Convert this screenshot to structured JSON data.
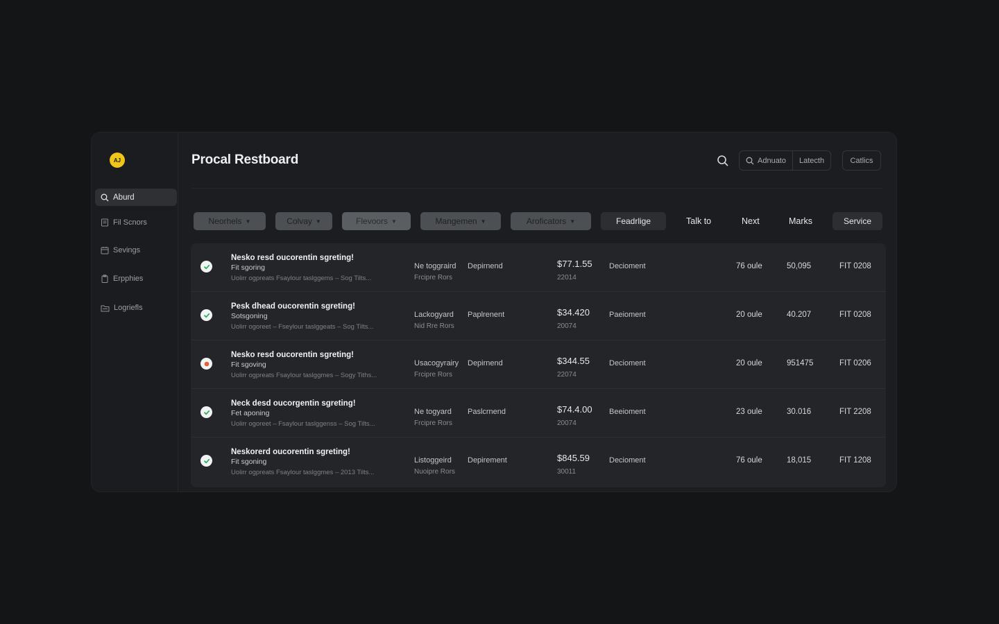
{
  "app": {
    "logo_text": "AJ",
    "title": "Procal Restboard"
  },
  "sidebar": {
    "search_label": "Aburd",
    "items": [
      {
        "label": "Fil Scnors",
        "icon": "document-icon"
      },
      {
        "label": "Sevings",
        "icon": "calendar-icon"
      },
      {
        "label": "Erpphies",
        "icon": "clipboard-icon"
      },
      {
        "label": "Logriefls",
        "icon": "folder-icon"
      }
    ]
  },
  "header": {
    "actions": [
      {
        "label": "Adnuato",
        "icon": "search-icon"
      },
      {
        "label": "Latecth"
      },
      {
        "label": "Catlics"
      }
    ]
  },
  "filters": {
    "dropdowns": [
      "Neorhels",
      "Colvay",
      "Flevoors",
      "Mangemen",
      "Aroficators"
    ],
    "active_tab": "Feadrlige",
    "tabs": [
      "Talk to",
      "Next",
      "Marks"
    ],
    "service_label": "Service"
  },
  "table": {
    "rows": [
      {
        "status": "ok",
        "title": "Nesko resd oucorentin sgreting!",
        "subtitle": "Fit sgoring",
        "detail": "Uolirr ogpreats Fsaylour taslggems – Sog Tilts...",
        "col_a_1": "Ne toggraird",
        "col_a_2": "Frcipre Rors",
        "col_b": "Depirnend",
        "price": "$77.1.55",
        "price_sub": "22014",
        "col_c": "Decioment",
        "col_d": "76 oule",
        "col_e": "50,095",
        "col_f": "FIT 0208"
      },
      {
        "status": "ok",
        "title": "Pesk dhead oucorentin sgreting!",
        "subtitle": "Sotsgoning",
        "detail": "Uolirr ogoreet – Fseylour taslggeats – Sog Tilts...",
        "col_a_1": "Lackogyard",
        "col_a_2": "Nid Rre Rors",
        "col_b": "Paplrenent",
        "price": "$34.420",
        "price_sub": "20074",
        "col_c": "Paeioment",
        "col_d": "20 oule",
        "col_e": "40.207",
        "col_f": "FIT 0208"
      },
      {
        "status": "alert",
        "title": "Nesko resd oucorentin sgreting!",
        "subtitle": "Fit sgoving",
        "detail": "Uolirr ogpreats Fsaylour taslggmes – Sogy Tiths...",
        "col_a_1": "Usacogyrairy",
        "col_a_2": "Frcipre Rors",
        "col_b": "Depirnend",
        "price": "$344.55",
        "price_sub": "22074",
        "col_c": "Decioment",
        "col_d": "20 oule",
        "col_e": "951475",
        "col_f": "FIT 0206"
      },
      {
        "status": "ok",
        "title": "Neck desd oucorgentin sgreting!",
        "subtitle": "Fet aponing",
        "detail": "Uolirr ogoreet – Fsaylour taslggenss – Sog Tilts...",
        "col_a_1": "Ne togyard",
        "col_a_2": "Frcipre Rors",
        "col_b": "Paslcrnend",
        "price": "$74.4.00",
        "price_sub": "20074",
        "col_c": "Beeioment",
        "col_d": "23 oule",
        "col_e": "30.016",
        "col_f": "FIT 2208"
      },
      {
        "status": "ok",
        "title": "Neskorerd oucorentin sgreting!",
        "subtitle": "Fit sgoning",
        "detail": "Uolirr ogpreats Fsaylour taslggmes – 2013 Tilts...",
        "col_a_1": "Listoggeird",
        "col_a_2": "Nuoipre Rors",
        "col_b": "Depirement",
        "price": "$845.59",
        "price_sub": "30011",
        "col_c": "Decioment",
        "col_d": "76 oule",
        "col_e": "18,015",
        "col_f": "FIT 1208"
      }
    ]
  },
  "colors": {
    "background": "#141517",
    "panel": "#1c1d20",
    "accent": "#f0c419",
    "ok": "#2fae5a",
    "alert": "#e0603a"
  }
}
